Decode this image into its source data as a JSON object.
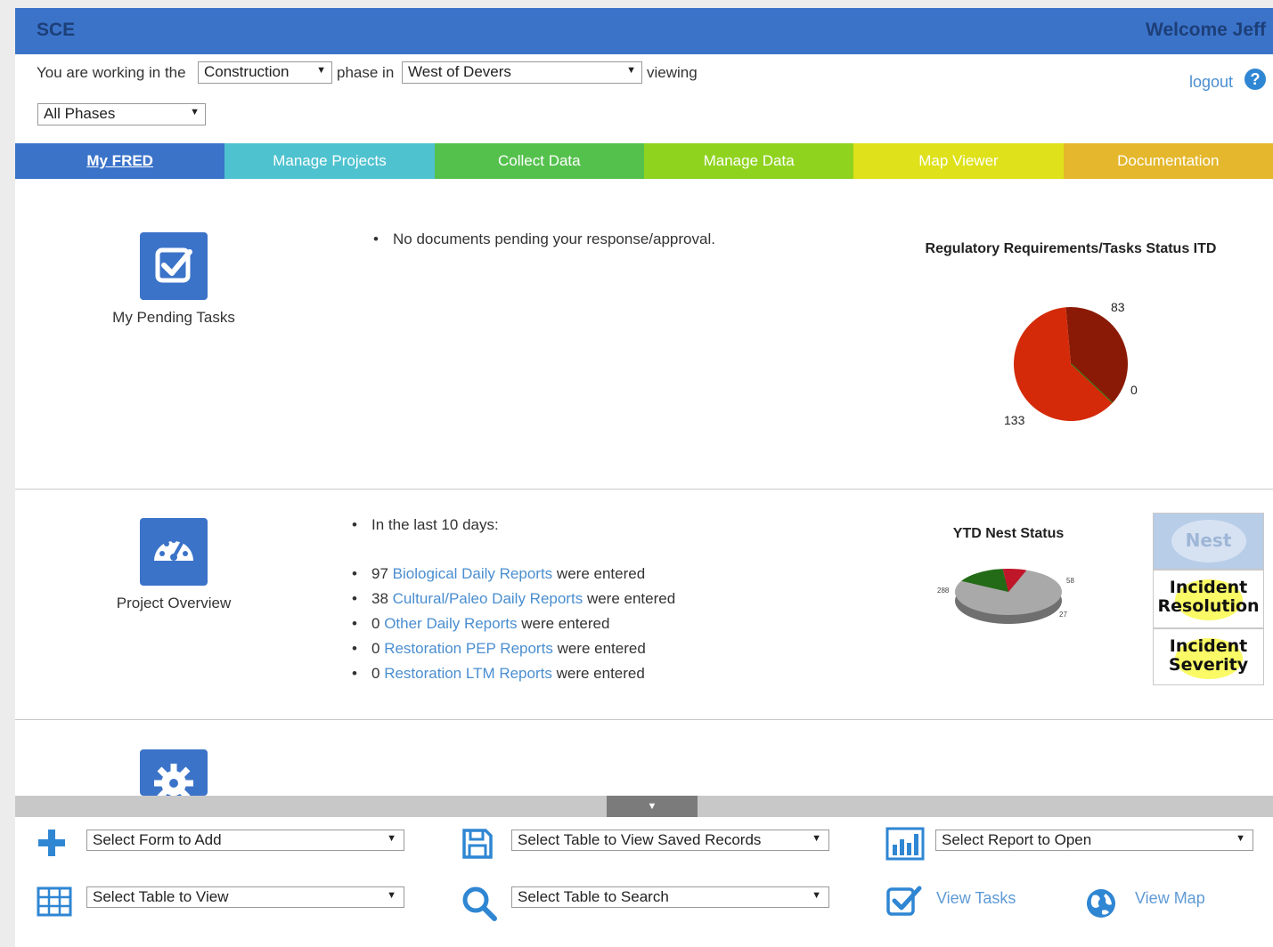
{
  "header": {
    "brand": "SCE",
    "welcome": "Welcome Jeff"
  },
  "context": {
    "prefix": "You are working in the",
    "phase_value": "Construction",
    "phase_in": "phase in",
    "project_value": "West of Devers",
    "viewing": "viewing",
    "view_value": "All Phases"
  },
  "account": {
    "logout": "logout",
    "help": "?"
  },
  "nav": {
    "tabs": [
      "My FRED",
      "Manage Projects",
      "Collect Data",
      "Manage Data",
      "Map Viewer",
      "Documentation"
    ]
  },
  "pending": {
    "label": "My Pending Tasks",
    "items": [
      "No documents pending your response/approval."
    ]
  },
  "overview": {
    "label": "Project Overview",
    "intro": "In the last 10 days:",
    "reports": [
      {
        "count": "97",
        "link": "Biological Daily Reports",
        "suffix": "were entered"
      },
      {
        "count": "38",
        "link": "Cultural/Paleo Daily Reports",
        "suffix": "were entered"
      },
      {
        "count": "0",
        "link": "Other Daily Reports",
        "suffix": "were entered"
      },
      {
        "count": "0",
        "link": "Restoration PEP Reports",
        "suffix": "were entered"
      },
      {
        "count": "0",
        "link": "Restoration LTM Reports",
        "suffix": "were entered"
      }
    ]
  },
  "side_buttons": {
    "nest": "Nest",
    "resolution": "Incident Resolution",
    "severity": "Incident Severity"
  },
  "chart_data": [
    {
      "type": "pie",
      "title": "Regulatory Requirements/Tasks Status ITD",
      "values": [
        83,
        0,
        133
      ],
      "labels": [
        "83",
        "0",
        "133"
      ],
      "colors": [
        "#8a1a05",
        "#2f8a1e",
        "#d42a0a"
      ]
    },
    {
      "type": "pie",
      "title": "YTD Nest Status",
      "values": [
        288,
        58,
        27
      ],
      "labels": [
        "288",
        "58",
        "27"
      ],
      "colors": [
        "#a9a9a9",
        "#236b17",
        "#c0162a"
      ]
    }
  ],
  "toolbar": {
    "form_add": "Select Form to Add",
    "saved_records": "Select Table to View Saved Records",
    "report_open": "Select Report to Open",
    "table_view": "Select Table to View",
    "table_search": "Select Table to Search",
    "view_tasks": "View Tasks",
    "view_map": "View Map"
  },
  "colors": {
    "primary": "#3b73c9",
    "link": "#4a8ed0"
  }
}
